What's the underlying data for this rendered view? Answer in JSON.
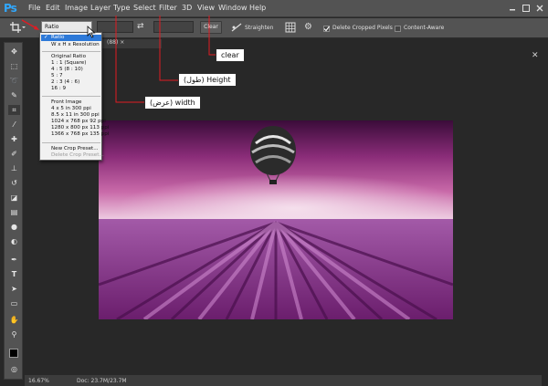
{
  "app": {
    "logo_text": "Ps"
  },
  "menubar": {
    "items": [
      {
        "label": "File"
      },
      {
        "label": "Edit"
      },
      {
        "label": "Image"
      },
      {
        "label": "Layer"
      },
      {
        "label": "Type"
      },
      {
        "label": "Select"
      },
      {
        "label": "Filter"
      },
      {
        "label": "3D"
      },
      {
        "label": "View"
      },
      {
        "label": "Window"
      },
      {
        "label": "Help"
      }
    ]
  },
  "options": {
    "ratio_value": "Ratio",
    "clear_label": "Clear",
    "straighten_label": "Straighten",
    "delete_cropped_label": "Delete Cropped Pixels",
    "delete_cropped_checked": true,
    "content_aware_label": "Content-Aware",
    "content_aware_checked": false
  },
  "document": {
    "tab_title": "(88) ×",
    "zoom": "16.67%",
    "doc_info": "Doc: 23.7M/23.7M"
  },
  "ratio_menu": {
    "items": [
      {
        "label": "Ratio",
        "state": "selected",
        "check": "✓"
      },
      {
        "label": "W x H x Resolution",
        "state": "normal"
      },
      {
        "label": "Original Ratio",
        "state": "normal"
      },
      {
        "label": "1 : 1 (Square)",
        "state": "normal"
      },
      {
        "label": "4 : 5 (8 : 10)",
        "state": "normal"
      },
      {
        "label": "5 : 7",
        "state": "normal"
      },
      {
        "label": "2 : 3 (4 : 6)",
        "state": "normal"
      },
      {
        "label": "16 : 9",
        "state": "normal"
      },
      {
        "label": "Front Image",
        "state": "normal"
      },
      {
        "label": "4 x 5 in 300 ppi",
        "state": "normal"
      },
      {
        "label": "8.5 x 11 in 300 ppi",
        "state": "normal"
      },
      {
        "label": "1024 x 768 px 92 ppi",
        "state": "normal"
      },
      {
        "label": "1280 x 800 px 113 ppi",
        "state": "normal"
      },
      {
        "label": "1366 x 768 px 135 ppi",
        "state": "normal"
      },
      {
        "label": "New Crop Preset...",
        "state": "normal"
      },
      {
        "label": "Delete Crop Preset...",
        "state": "disabled"
      }
    ]
  },
  "annotations": {
    "clear": "clear",
    "height": "(طول) Height",
    "width": "(عرض) width"
  },
  "colors": {
    "accent_red": "#e11b22",
    "selection_blue": "#2d79d8",
    "ps_blue": "#31a8ff"
  },
  "tools": [
    "move-icon",
    "marquee-icon",
    "lasso-icon",
    "quick-select-icon",
    "crop-icon",
    "eyedropper-icon",
    "healing-icon",
    "brush-icon",
    "clone-stamp-icon",
    "history-brush-icon",
    "eraser-icon",
    "gradient-icon",
    "blur-icon",
    "dodge-icon",
    "pen-icon",
    "type-icon",
    "path-select-icon",
    "shape-icon",
    "hand-icon",
    "zoom-icon"
  ]
}
